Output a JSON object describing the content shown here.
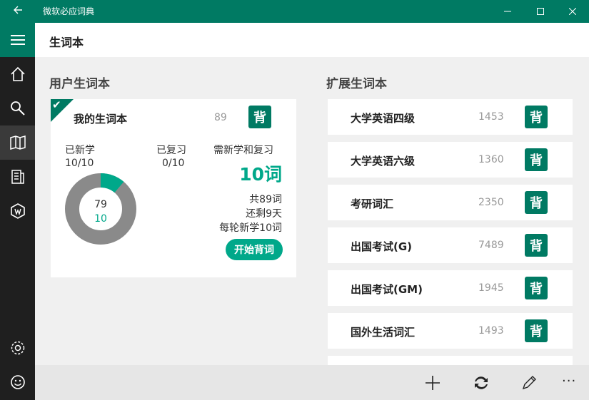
{
  "window": {
    "title": "微软必应词典",
    "back_icon": "back-arrow-icon",
    "colors": {
      "accent": "#007a63",
      "accent_light": "#00a88a",
      "sidebar": "#1f1f1f"
    }
  },
  "sidebar": {
    "items": [
      {
        "icon": "menu-icon"
      },
      {
        "icon": "home-icon"
      },
      {
        "icon": "search-icon"
      },
      {
        "icon": "book-icon",
        "active": true
      },
      {
        "icon": "news-icon"
      },
      {
        "icon": "wordchallenge-icon"
      },
      {
        "icon": "settings-icon"
      },
      {
        "icon": "smiley-icon"
      }
    ]
  },
  "header": {
    "title": "生词本"
  },
  "user_section": {
    "title": "用户生词本",
    "card": {
      "name": "我的生词本",
      "count": "89",
      "bei_label": "背",
      "new_label": "已新学",
      "new_value": "10/10",
      "review_label": "已复习",
      "review_value": "0/10",
      "need_label": "需新学和复习",
      "need_value": "10词",
      "total_line": "共89词",
      "days_line": "还剩9天",
      "per_round_line": "每轮新学10词",
      "start_button": "开始背词",
      "donut_top": "79",
      "donut_bottom": "10",
      "donut_fraction": 0.112
    }
  },
  "ext_section": {
    "title": "扩展生词本",
    "items": [
      {
        "name": "大学英语四级",
        "count": "1453",
        "bei": "背"
      },
      {
        "name": "大学英语六级",
        "count": "1360",
        "bei": "背"
      },
      {
        "name": "考研词汇",
        "count": "2350",
        "bei": "背"
      },
      {
        "name": "出国考试(G)",
        "count": "7489",
        "bei": "背"
      },
      {
        "name": "出国考试(GM)",
        "count": "1945",
        "bei": "背"
      },
      {
        "name": "国外生活词汇",
        "count": "1493",
        "bei": "背"
      }
    ]
  },
  "bottom_bar": {
    "buttons": [
      "add-icon",
      "sync-icon",
      "edit-icon"
    ],
    "more_label": "···"
  }
}
